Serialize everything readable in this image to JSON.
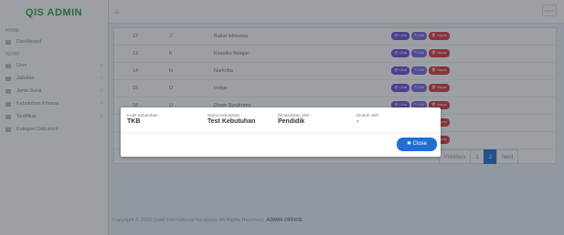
{
  "app": {
    "logo": "QIS ADMIN"
  },
  "sidebar": {
    "sections": [
      {
        "label": "HOME",
        "items": [
          {
            "label": "Dashboard",
            "icon": "dashboard-icon",
            "chevron": false
          }
        ]
      },
      {
        "label": "WORK",
        "items": [
          {
            "label": "User",
            "icon": "user-icon",
            "chevron": true
          },
          {
            "label": "Jabatan",
            "icon": "briefcase-icon",
            "chevron": true
          },
          {
            "label": "Jenis Surat",
            "icon": "file-icon",
            "chevron": true
          },
          {
            "label": "Kebutuhan Khusus",
            "icon": "accessibility-icon",
            "chevron": true
          },
          {
            "label": "Sertifikat",
            "icon": "certificate-icon",
            "chevron": true
          },
          {
            "label": "Kategori Dokumen",
            "icon": "folder-icon",
            "chevron": false
          }
        ]
      }
    ]
  },
  "topbar": {
    "menu_icon": "hamburger-icon",
    "user_label": "Admin"
  },
  "table": {
    "rows": [
      {
        "no": "12",
        "kode": "J",
        "nama": "Bakat Istimewa"
      },
      {
        "no": "13",
        "kode": "K",
        "nama": "Kesulita Belajar"
      },
      {
        "no": "14",
        "kode": "N",
        "nama": "Narkoba"
      },
      {
        "no": "15",
        "kode": "O",
        "nama": "Indigo"
      },
      {
        "no": "16",
        "kode": "U",
        "nama": "Down Syndrome"
      },
      {
        "no": "",
        "kode": "",
        "nama": ""
      },
      {
        "no": "",
        "kode": "",
        "nama": ""
      }
    ],
    "actions": {
      "view": "Lihat",
      "edit": "Edit",
      "delete": "Hapus"
    }
  },
  "pagination": {
    "prev": "Previous",
    "pages": [
      "1",
      "2"
    ],
    "active": "2",
    "next": "Next"
  },
  "footer": {
    "text": "Copyright © 2019 Quali International Surabaya. All Rights Reserved.",
    "brand": "ADMIN OFFICE"
  },
  "modal": {
    "fields": [
      {
        "key": "Kode Kebutuhan :",
        "value": "TKB"
      },
      {
        "key": "Nama Kebutuhan :",
        "value": "Test Kebutuhan"
      },
      {
        "key": "Dimasukkan oleh :",
        "value": "Pendidik"
      },
      {
        "key": "Diubah oleh :",
        "value": "-"
      }
    ],
    "close_label": "✖ Close"
  },
  "colors": {
    "brand": "#2f9e44",
    "primary": "#1e6fd9",
    "danger": "#d93a3a",
    "view": "#6c4fd6",
    "edit": "#7d66e0"
  }
}
